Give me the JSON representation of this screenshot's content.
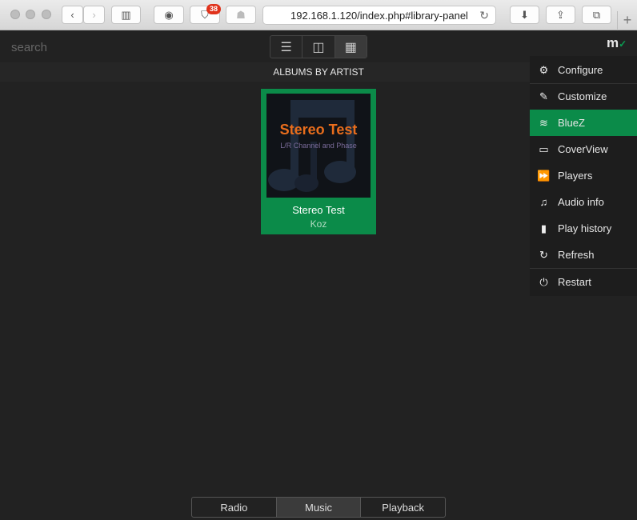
{
  "browser": {
    "address": "192.168.1.120/index.php#library-panel",
    "badge_count": "38"
  },
  "app": {
    "search_placeholder": "search",
    "logo_text": "m",
    "logo_check": "✓",
    "header_title": "ALBUMS BY ARTIST"
  },
  "album": {
    "cover_title": "Stereo Test",
    "cover_subtitle": "L/R Channel and Phase",
    "name": "Stereo Test",
    "artist": "Koz"
  },
  "menu": {
    "items": [
      {
        "label": "Configure",
        "icon": "gear-icon",
        "glyph": "⚙"
      },
      {
        "label": "Customize",
        "icon": "edit-icon",
        "glyph": "✎"
      },
      {
        "label": "BlueZ",
        "icon": "wifi-icon",
        "glyph": "≋"
      },
      {
        "label": "CoverView",
        "icon": "monitor-icon",
        "glyph": "▭"
      },
      {
        "label": "Players",
        "icon": "fast-forward-icon",
        "glyph": "⏩"
      },
      {
        "label": "Audio info",
        "icon": "music-note-icon",
        "glyph": "♫"
      },
      {
        "label": "Play history",
        "icon": "book-icon",
        "glyph": "▮"
      },
      {
        "label": "Refresh",
        "icon": "refresh-icon",
        "glyph": "↻"
      },
      {
        "label": "Restart",
        "icon": "power-icon",
        "glyph": "⏻"
      }
    ]
  },
  "tabs": {
    "radio": "Radio",
    "music": "Music",
    "playback": "Playback"
  },
  "colors": {
    "accent": "#0b8b49",
    "background": "#222222"
  }
}
